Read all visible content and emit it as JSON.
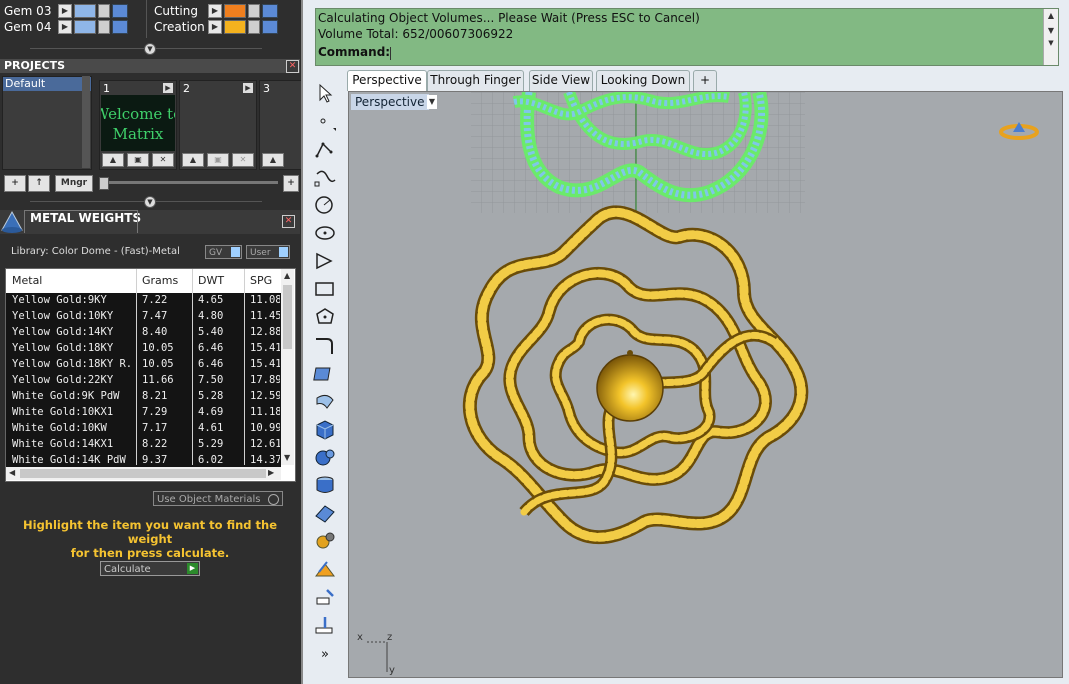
{
  "layers": [
    {
      "name": "Gem 03",
      "color": "#8fb6e8"
    },
    {
      "name": "Gem 04",
      "color": "#8fb6e8"
    },
    {
      "name": "Cutting",
      "color": "#f07f1e"
    },
    {
      "name": "Creation",
      "color": "#f4b21e"
    }
  ],
  "projects": {
    "title": "PROJECTS",
    "list": [
      "Default"
    ],
    "slots": [
      "1",
      "2",
      "3"
    ],
    "welcome_text": "Welcome to Matrix",
    "mngr_label": "Mngr",
    "plus": "+",
    "up": "↑"
  },
  "metal_weights": {
    "title": "METAL WEIGHTS",
    "library": "Library: Color Dome - (Fast)-Metal",
    "toggle_gv": "GV",
    "toggle_user": "User",
    "columns": [
      "Metal",
      "Grams",
      "DWT",
      "SPG"
    ],
    "rows": [
      [
        "Yellow Gold:9KY",
        "7.22",
        "4.65",
        "11.08"
      ],
      [
        "Yellow Gold:10KY",
        "7.47",
        "4.80",
        "11.45"
      ],
      [
        "Yellow Gold:14KY",
        "8.40",
        "5.40",
        "12.88"
      ],
      [
        "Yellow Gold:18KY",
        "10.05",
        "6.46",
        "15.41"
      ],
      [
        "Yellow Gold:18KY R...",
        "10.05",
        "6.46",
        "15.41"
      ],
      [
        "Yellow Gold:22KY",
        "11.66",
        "7.50",
        "17.89"
      ],
      [
        "White Gold:9K PdW",
        "8.21",
        "5.28",
        "12.59"
      ],
      [
        "White Gold:10KX1",
        "7.29",
        "4.69",
        "11.18"
      ],
      [
        "White Gold:10KW",
        "7.17",
        "4.61",
        "10.99"
      ],
      [
        "White Gold:14KX1",
        "8.22",
        "5.29",
        "12.61"
      ],
      [
        "White Gold:14K PdW",
        "9.37",
        "6.02",
        "14.37"
      ]
    ],
    "use_object_materials": "Use Object Materials",
    "hint_line1": "Highlight the item you want to find the weight",
    "hint_line2": "for then press calculate.",
    "calculate": "Calculate"
  },
  "command": {
    "line1": "Calculating Object Volumes... Please Wait (Press ESC to Cancel)",
    "line2": "Volume Total: 652/00607306922",
    "prompt": "Command:"
  },
  "viewport": {
    "tabs": [
      "Perspective",
      "Through Finger",
      "Side View",
      "Looking Down",
      "+"
    ],
    "active_tab": "Perspective",
    "label": "Perspective",
    "axis_x": "x",
    "axis_z": "z",
    "axis_y": "y"
  },
  "colors": {
    "gold": "#e0b52a",
    "gold_dark": "#8a6410",
    "green_outline": "#6bea6b",
    "stones": "#7fc7e8",
    "viewport_bg": "#a5a9ad",
    "command_bg": "#82b983"
  }
}
